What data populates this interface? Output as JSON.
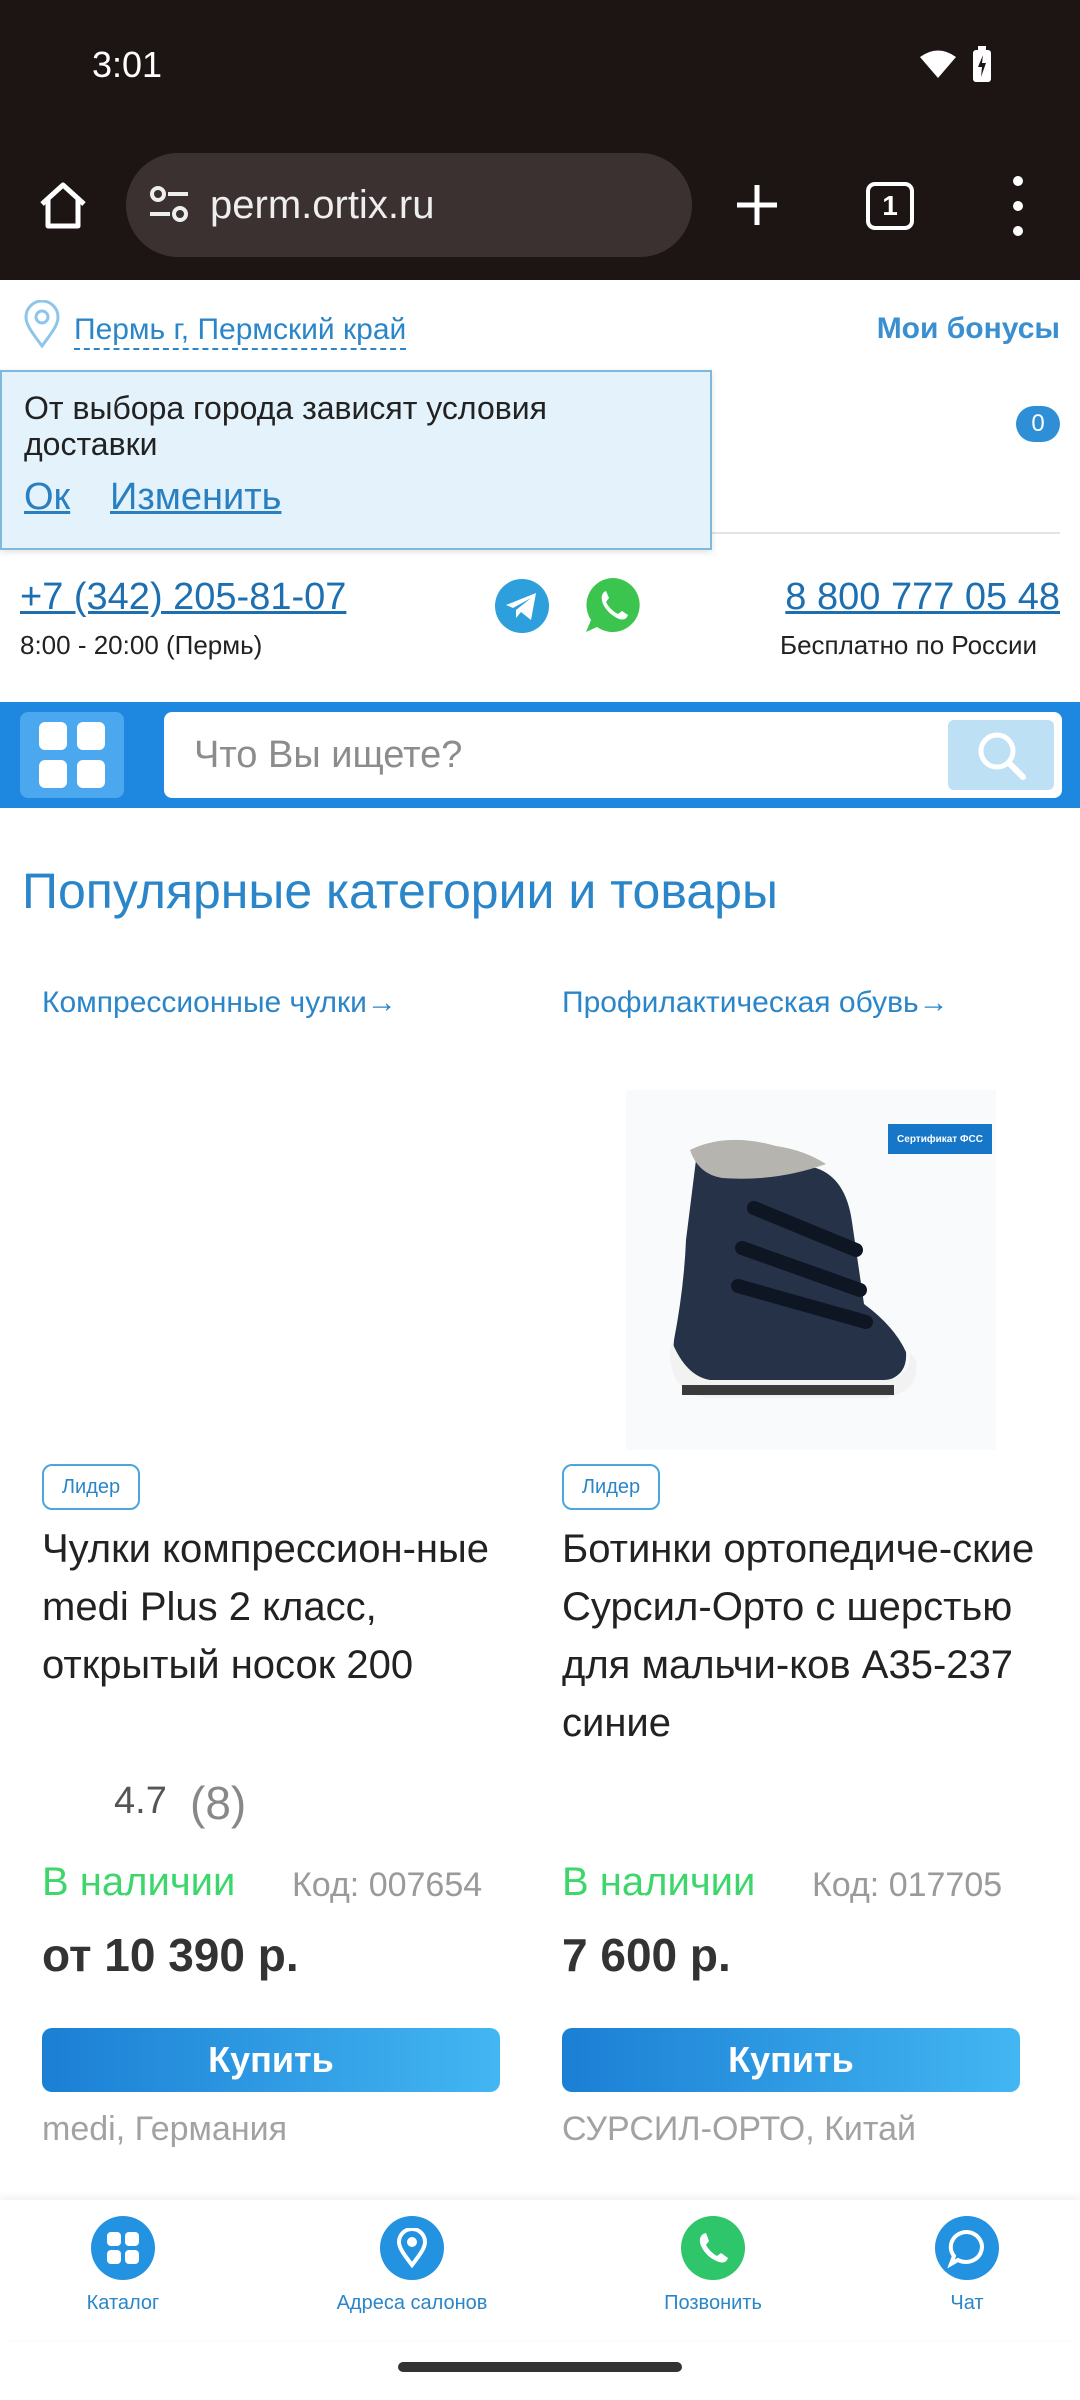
{
  "status_bar": {
    "time": "3:01"
  },
  "browser": {
    "url": "perm.ortix.ru",
    "tab_count": "1"
  },
  "header": {
    "city": "Пермь г, Пермский край",
    "bonuses": "Мои бонусы",
    "cart_count": "0",
    "city_popup": {
      "message": "От выбора города зависят условия доставки",
      "ok": "Ок",
      "change": "Изменить"
    },
    "phone_local": "+7 (342) 205-81-07",
    "hours_local": "8:00 - 20:00 (Пермь)",
    "phone_free": "8 800 777 05 48",
    "free_note": "Бесплатно по России"
  },
  "search": {
    "placeholder": "Что Вы ищете?"
  },
  "popular": {
    "title": "Популярные категории и товары",
    "products": [
      {
        "category": "Компрессионные чулки→",
        "badge": "Лидер",
        "title": "Чулки компрессион-ные medi Plus 2 класс, открытый носок 200",
        "rating": "4.7",
        "rating_count": "(8)",
        "stock": "В наличии",
        "code": "Код: 007654",
        "price": "от 10 390 р.",
        "buy": "Купить",
        "brand": "medi, Германия"
      },
      {
        "category": "Профилактическая обувь→",
        "cert": "Сертификат ФСС",
        "badge": "Лидер",
        "title": "Ботинки ортопедиче-ские Сурсил-Орто с шерстью для мальчи-ков А35-237 синие",
        "stock": "В наличии",
        "code": "Код: 017705",
        "price": "7 600 р.",
        "buy": "Купить",
        "brand": "СУРСИЛ-ОРТО, Китай"
      }
    ]
  },
  "bottom_nav": [
    {
      "label": "Каталог",
      "icon": "grid-icon"
    },
    {
      "label": "Адреса салонов",
      "icon": "location-pin-icon"
    },
    {
      "label": "Позвонить",
      "icon": "phone-icon"
    },
    {
      "label": "Чат",
      "icon": "chat-icon"
    }
  ],
  "colors": {
    "accent": "#2a86c9",
    "search_strip": "#1e88e0",
    "in_stock": "#3cd66b"
  }
}
